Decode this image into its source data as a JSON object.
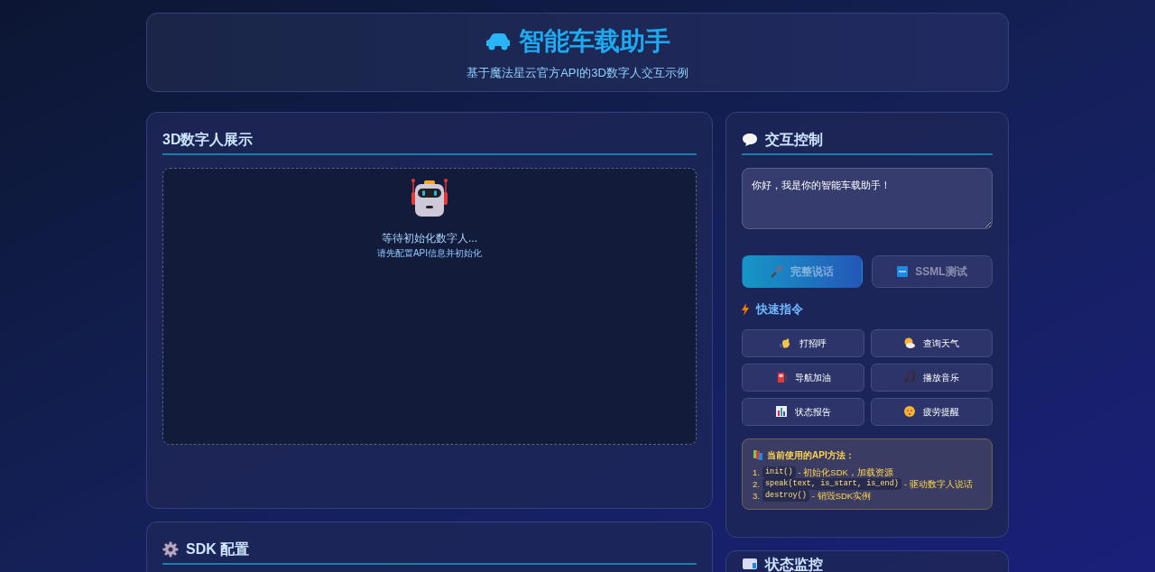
{
  "header": {
    "title": "智能车载助手",
    "subtitle": "基于魔法星云官方API的3D数字人交互示例"
  },
  "display": {
    "title": "3D数字人展示",
    "status": "等待初始化数字人...",
    "hint": "请先配置API信息并初始化"
  },
  "sdk": {
    "title": "SDK 配置"
  },
  "control": {
    "title": "交互控制",
    "input_value": "你好，我是你的智能车载助手！",
    "buttons": [
      {
        "label": "完整说话",
        "kind": "primary",
        "disabled": true
      },
      {
        "label": "SSML测试",
        "kind": "secondary",
        "disabled": true
      }
    ],
    "quick_title": "快速指令",
    "quick": [
      "打招呼",
      "查询天气",
      "导航加油",
      "播放音乐",
      "状态报告",
      "疲劳提醒"
    ],
    "api": {
      "title": "当前使用的API方法：",
      "items": [
        {
          "number": "1.",
          "code": "init()",
          "desc": "- 初始化SDK，加载资源"
        },
        {
          "number": "2.",
          "code": "speak(text, is_start, is_end)",
          "desc": "- 驱动数字人说话"
        },
        {
          "number": "3.",
          "code": "destroy()",
          "desc": "- 销毁SDK实例"
        }
      ]
    }
  },
  "status": {
    "title": "状态监控"
  }
}
